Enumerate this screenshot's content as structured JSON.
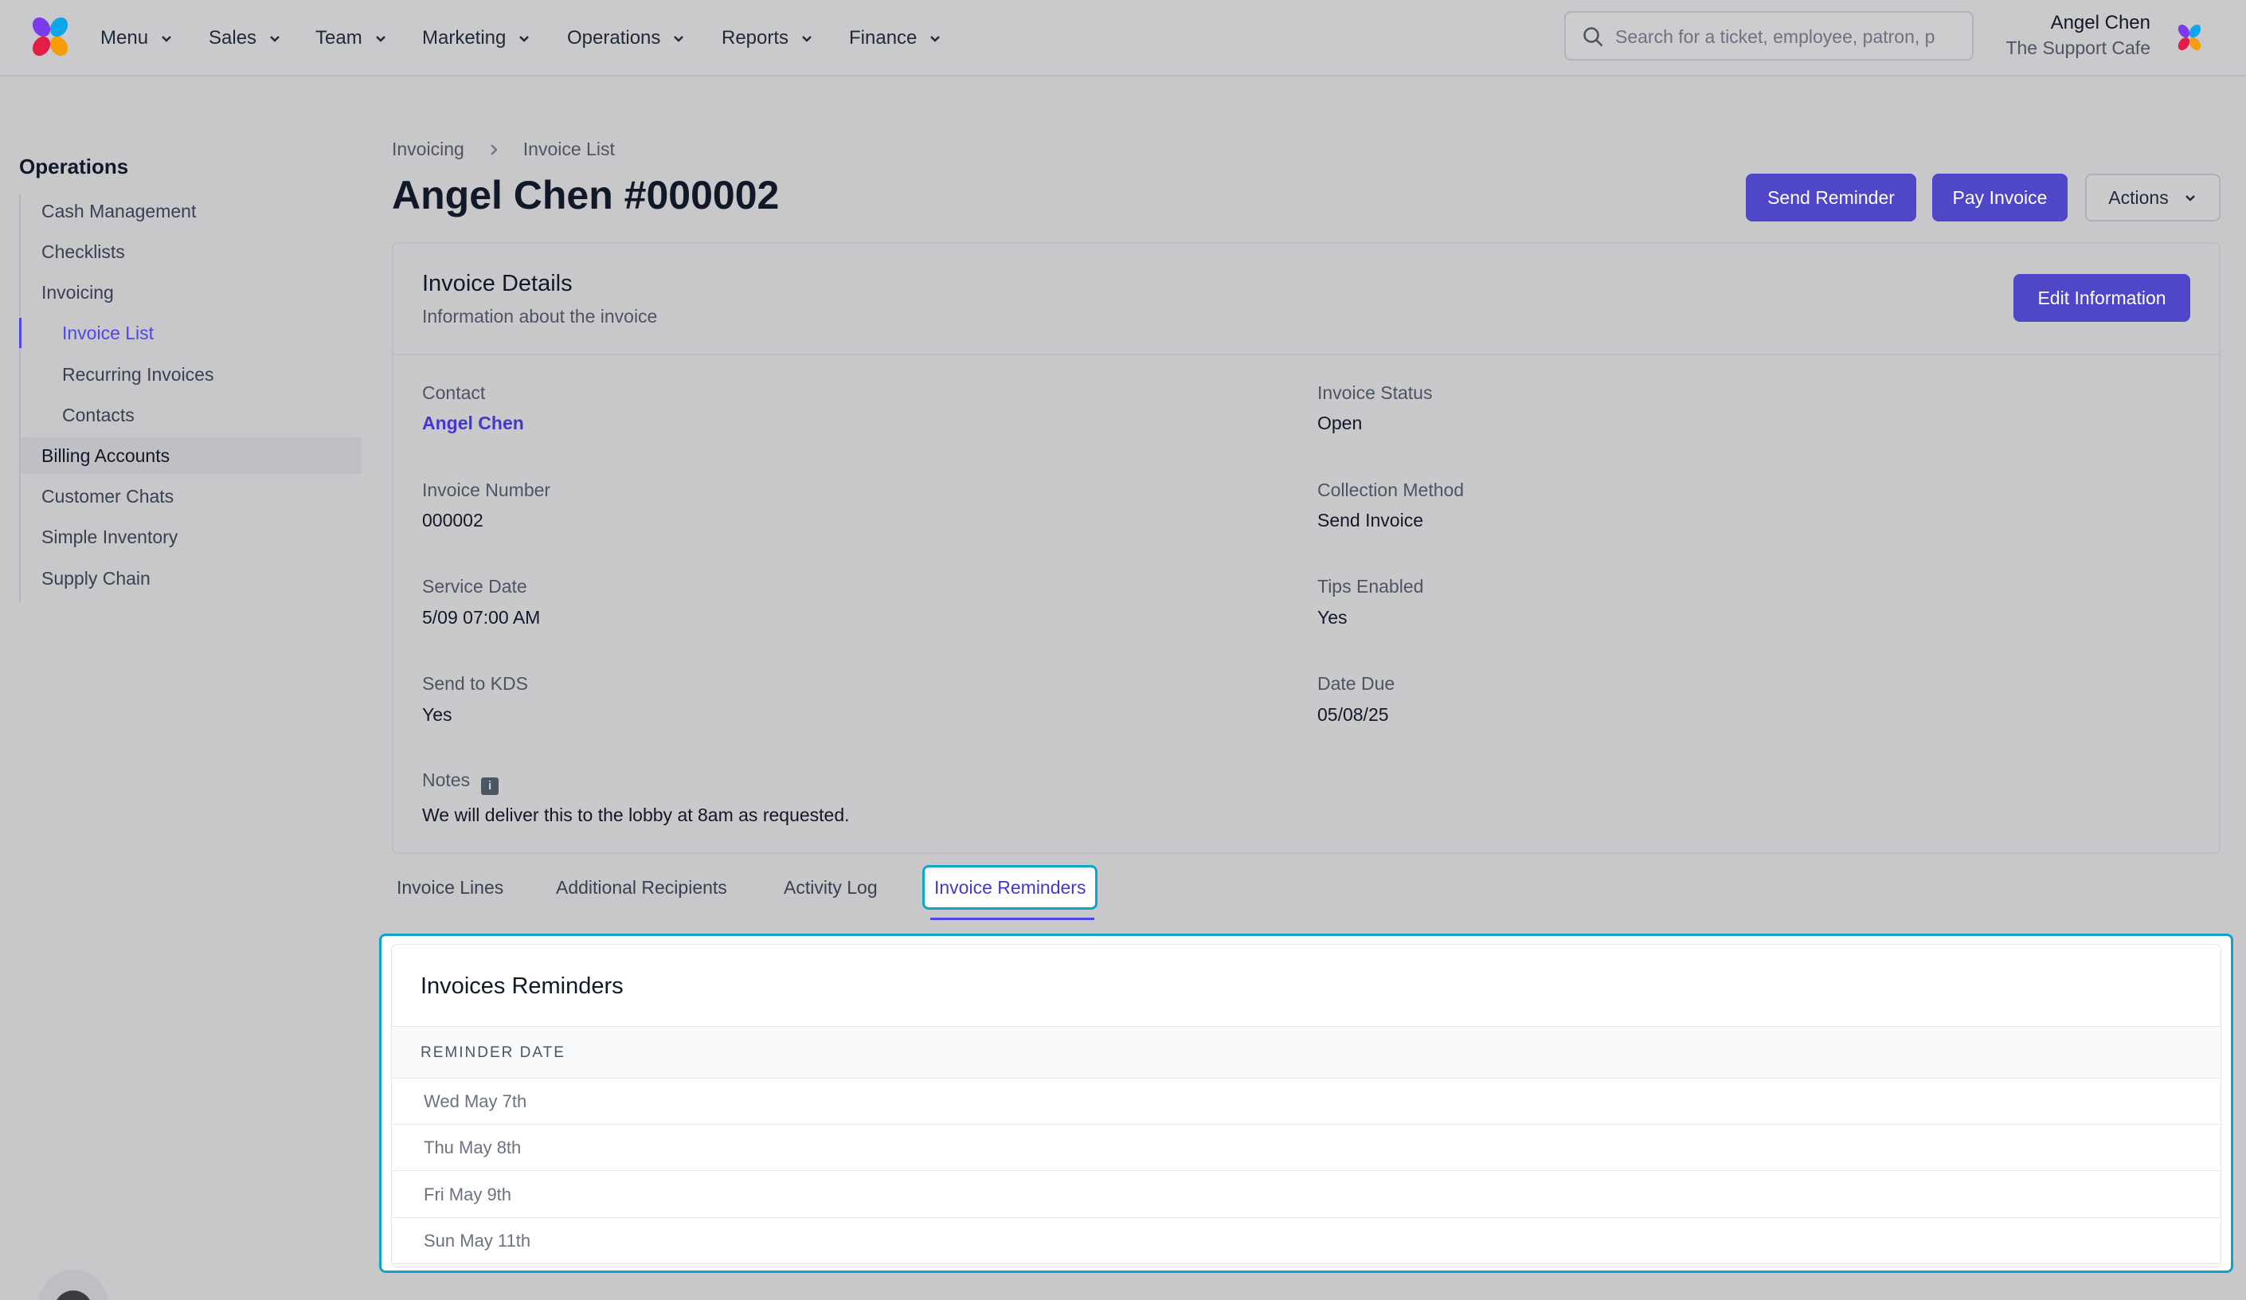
{
  "topbar": {
    "nav": [
      "Menu",
      "Sales",
      "Team",
      "Marketing",
      "Operations",
      "Reports",
      "Finance"
    ],
    "search_placeholder": "Search for a ticket, employee, patron, p",
    "user_name": "Angel Chen",
    "user_org": "The Support Cafe"
  },
  "sidebar": {
    "title": "Operations",
    "items": [
      {
        "label": "Cash Management"
      },
      {
        "label": "Checklists"
      },
      {
        "label": "Invoicing"
      },
      {
        "label": "Invoice List"
      },
      {
        "label": "Recurring Invoices"
      },
      {
        "label": "Contacts"
      },
      {
        "label": "Billing Accounts"
      },
      {
        "label": "Customer Chats"
      },
      {
        "label": "Simple Inventory"
      },
      {
        "label": "Supply Chain"
      }
    ]
  },
  "header": {
    "breadcrumb": [
      "Invoicing",
      "Invoice List"
    ],
    "title": "Angel Chen #000002",
    "send_reminder": "Send Reminder",
    "pay_invoice": "Pay Invoice",
    "actions": "Actions"
  },
  "details": {
    "title": "Invoice Details",
    "subtitle": "Information about the invoice",
    "edit_button": "Edit Information",
    "fields": {
      "contact": {
        "label": "Contact",
        "value": "Angel Chen"
      },
      "invoice_status": {
        "label": "Invoice Status",
        "value": "Open"
      },
      "invoice_number": {
        "label": "Invoice Number",
        "value": "000002"
      },
      "collection_method": {
        "label": "Collection Method",
        "value": "Send Invoice"
      },
      "service_date": {
        "label": "Service Date",
        "value": "5/09 07:00 AM"
      },
      "tips_enabled": {
        "label": "Tips Enabled",
        "value": "Yes"
      },
      "send_to_kds": {
        "label": "Send to KDS",
        "value": "Yes"
      },
      "date_due": {
        "label": "Date Due",
        "value": "05/08/25"
      },
      "notes": {
        "label": "Notes",
        "value": "We will deliver this to the lobby at 8am as requested."
      }
    }
  },
  "tabs": [
    "Invoice Lines",
    "Additional Recipients",
    "Activity Log",
    "Invoice Reminders"
  ],
  "reminders": {
    "title": "Invoices Reminders",
    "column": "REMINDER DATE",
    "rows": [
      "Wed May 7th",
      "Thu May 8th",
      "Fri May 9th",
      "Sun May 11th"
    ]
  },
  "colors": {
    "accent": "#4f46e5",
    "primary_button": "#4f46c8",
    "highlight": "#0ea5c6"
  }
}
